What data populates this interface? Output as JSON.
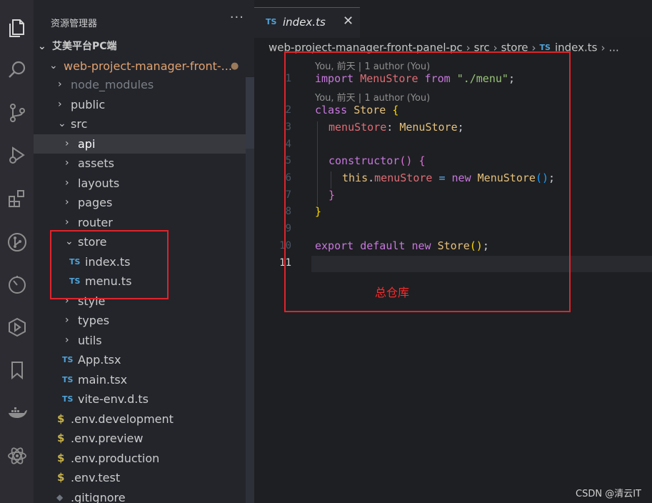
{
  "activity_bar": {
    "items": [
      {
        "name": "explorer-icon"
      },
      {
        "name": "search-icon"
      },
      {
        "name": "source-control-icon"
      },
      {
        "name": "run-debug-icon"
      },
      {
        "name": "extensions-icon"
      },
      {
        "name": "git-graph-icon"
      },
      {
        "name": "timeline-icon"
      },
      {
        "name": "live-share-icon"
      },
      {
        "name": "bookmarks-icon"
      },
      {
        "name": "docker-icon"
      },
      {
        "name": "react-icon"
      }
    ]
  },
  "sidebar": {
    "title": "资源管理器",
    "more": "···",
    "tree": [
      {
        "label": "艾美平台PC端",
        "kind": "root"
      },
      {
        "label": "web-project-manager-front-...",
        "kind": "folder-open",
        "status": "●"
      },
      {
        "label": "node_modules",
        "kind": "folder"
      },
      {
        "label": "public",
        "kind": "folder"
      },
      {
        "label": "src",
        "kind": "folder-open"
      },
      {
        "label": "api",
        "kind": "folder"
      },
      {
        "label": "assets",
        "kind": "folder"
      },
      {
        "label": "layouts",
        "kind": "folder"
      },
      {
        "label": "pages",
        "kind": "folder"
      },
      {
        "label": "router",
        "kind": "folder"
      },
      {
        "label": "store",
        "kind": "folder-open"
      },
      {
        "label": "index.ts",
        "kind": "ts"
      },
      {
        "label": "menu.ts",
        "kind": "ts"
      },
      {
        "label": "style",
        "kind": "folder"
      },
      {
        "label": "types",
        "kind": "folder"
      },
      {
        "label": "utils",
        "kind": "folder"
      },
      {
        "label": "App.tsx",
        "kind": "ts"
      },
      {
        "label": "main.tsx",
        "kind": "ts"
      },
      {
        "label": "vite-env.d.ts",
        "kind": "ts"
      },
      {
        "label": ".env.development",
        "kind": "env"
      },
      {
        "label": ".env.preview",
        "kind": "env"
      },
      {
        "label": ".env.production",
        "kind": "env"
      },
      {
        "label": ".env.test",
        "kind": "env"
      },
      {
        "label": ".gitignore",
        "kind": "git"
      }
    ]
  },
  "editor": {
    "tab": {
      "badge": "TS",
      "label": "index.ts",
      "close": "✕"
    },
    "breadcrumb": {
      "items": [
        "web-project-manager-front-panel-pc",
        "src",
        "store"
      ],
      "file_badge": "TS",
      "file": "index.ts",
      "trail": "..."
    },
    "codelens": [
      "You, 前天 | 1 author (You)",
      "You, 前天 | 1 author (You)"
    ],
    "line_numbers": [
      "1",
      "2",
      "3",
      "4",
      "5",
      "6",
      "7",
      "8",
      "9",
      "10",
      "11"
    ],
    "active_line": "11",
    "code": {
      "l1": [
        "import",
        " ",
        "MenuStore",
        " ",
        "from",
        " ",
        "\"./menu\"",
        ";"
      ],
      "l2": [
        "class",
        " ",
        "Store",
        " ",
        "{"
      ],
      "l3": [
        "menuStore",
        ":",
        " ",
        "MenuStore",
        ";"
      ],
      "l5": [
        "constructor",
        "(",
        ")",
        " ",
        "{"
      ],
      "l6": [
        "this",
        ".",
        "menuStore",
        " ",
        "=",
        " ",
        "new",
        " ",
        "MenuStore",
        "(",
        ")",
        ";"
      ],
      "l7": [
        "}"
      ],
      "l8": [
        "}"
      ],
      "l10": [
        "export",
        " ",
        "default",
        " ",
        "new",
        " ",
        "Store",
        "(",
        ")",
        ";"
      ]
    }
  },
  "annotation": {
    "text": "总仓库",
    "color": "#ff2a2a"
  },
  "watermark": "CSDN @清云IT",
  "colors": {
    "accent_ts": "#4fa3d9",
    "keyword": "#c678dd",
    "class": "#e5c07b",
    "variable": "#e06c75",
    "string": "#98c379",
    "function": "#61afef",
    "highlight_box": "#e0242a"
  }
}
